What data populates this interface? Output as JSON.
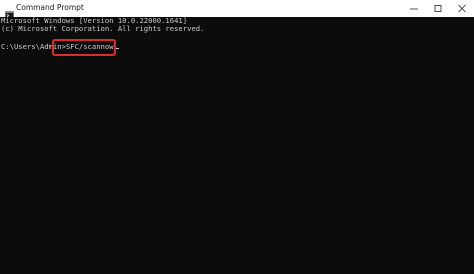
{
  "window": {
    "title": "Command Prompt",
    "icon": "cmd-icon",
    "controls": [
      "minimize-icon",
      "maximize-icon",
      "close-icon"
    ]
  },
  "console": {
    "line1": "Microsoft Windows [Version 10.0.22000.1641]",
    "line2": "(c) Microsoft Corporation. All rights reserved.",
    "prompt": "C:\\Users\\Admin>",
    "command": "SFC/scannow"
  },
  "colors": {
    "console_bg": "#0c0c0c",
    "console_text": "#cccccc",
    "titlebar_bg": "#ffffff",
    "highlight": "#e02a2a"
  }
}
